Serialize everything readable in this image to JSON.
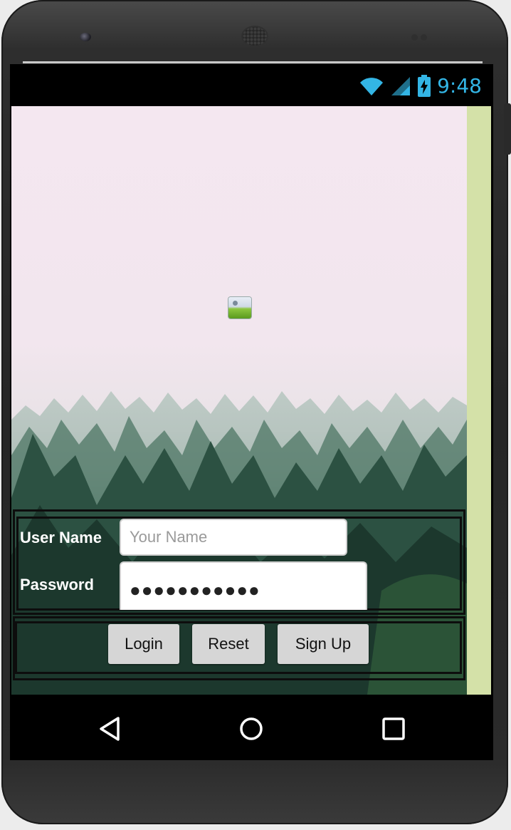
{
  "status_bar": {
    "time": "9:48",
    "wifi_icon": "wifi-icon",
    "signal_icon": "cell-signal-icon",
    "battery_icon": "battery-charging-icon",
    "accent": "#33b5e5"
  },
  "image_placeholder_icon": "broken-image-icon",
  "form": {
    "username_label": "User Name",
    "username_placeholder": "Your Name",
    "username_value": "",
    "password_label": "Password",
    "password_value": "●●●●●●●●●●●"
  },
  "buttons": {
    "login": "Login",
    "reset": "Reset",
    "signup": "Sign Up"
  },
  "nav": {
    "back_icon": "back-triangle-icon",
    "home_icon": "home-circle-icon",
    "recents_icon": "recents-square-icon"
  },
  "colors": {
    "side_strip": "#d4e1a8",
    "button_bg": "#d6d6d6"
  }
}
